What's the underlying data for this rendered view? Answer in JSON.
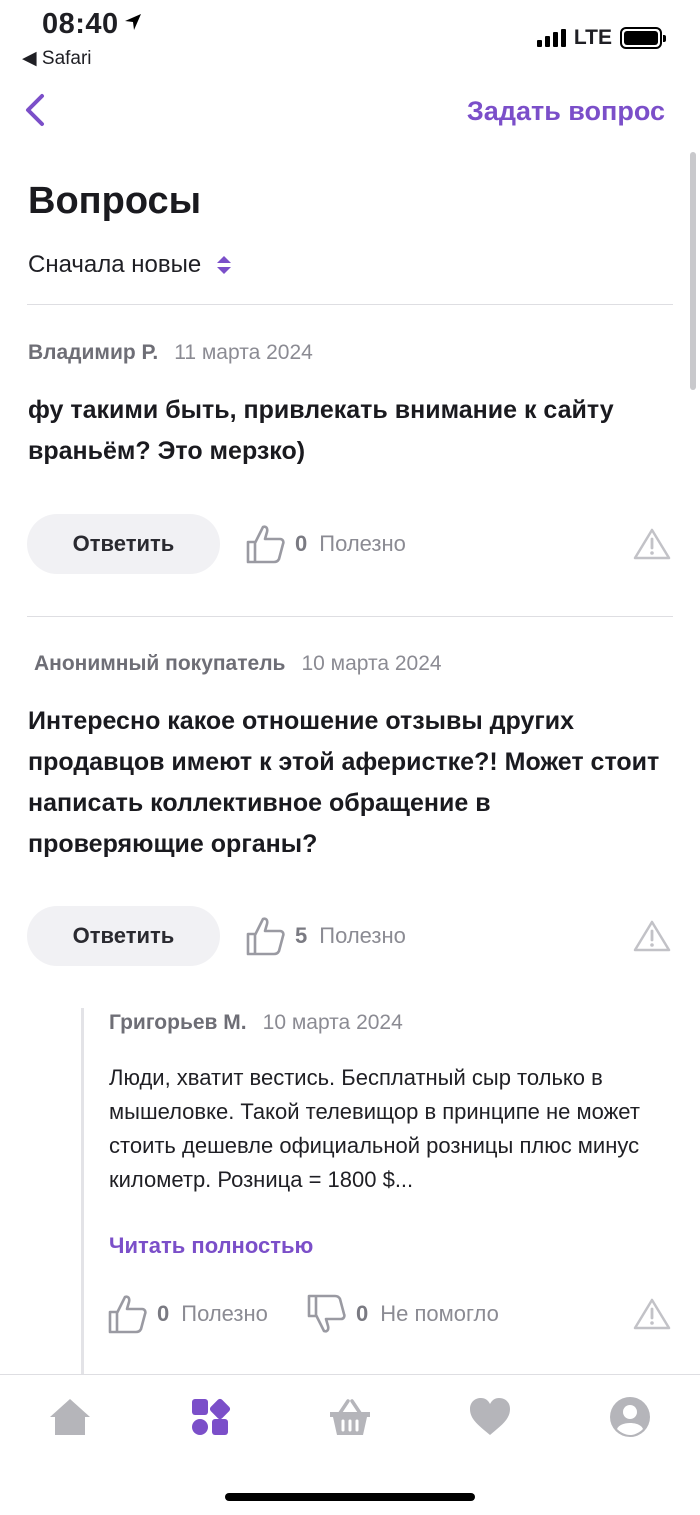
{
  "status_bar": {
    "time": "08:40",
    "back_app": "◀ Safari",
    "network": "LTE"
  },
  "nav": {
    "ask_label": "Задать вопрос"
  },
  "page": {
    "title": "Вопросы",
    "sort_label": "Сначала новые"
  },
  "questions": [
    {
      "author": "Владимир Р.",
      "date": "11 марта 2024",
      "text": "фу такими быть, привлекать внимание к сайту враньём? Это мерзко)",
      "reply_label": "Ответить",
      "useful_count": "0",
      "useful_label": "Полезно"
    },
    {
      "author": "Анонимный покупатель",
      "date": "10 марта 2024",
      "text": "Интересно какое отношение отзывы других продавцов имеют к этой аферистке?! Может стоит написать коллективное обращение в проверяющие органы?",
      "reply_label": "Ответить",
      "useful_count": "5",
      "useful_label": "Полезно"
    }
  ],
  "answer": {
    "author": "Григорьев М.",
    "date": "10 марта 2024",
    "text": "Люди, хватит вестись. Бесплатный сыр только в мышеловке. Такой телевищор в принципе не может стоить дешевле официальной розницы плюс минус километр. Розница = 1800 $...",
    "read_more": "Читать полностью",
    "useful_count": "0",
    "useful_label": "Полезно",
    "not_helpful_count": "0",
    "not_helpful_label": "Не помогло"
  },
  "tabbar": {
    "items": [
      {
        "icon": "home-icon",
        "active": false
      },
      {
        "icon": "catalog-icon",
        "active": true
      },
      {
        "icon": "basket-icon",
        "active": false
      },
      {
        "icon": "heart-icon",
        "active": false
      },
      {
        "icon": "profile-icon",
        "active": false
      }
    ]
  },
  "colors": {
    "accent": "#7b4fc9",
    "muted": "#8b8b93",
    "icon_gray": "#b5b5ba",
    "button_bg": "#f1f1f4"
  }
}
